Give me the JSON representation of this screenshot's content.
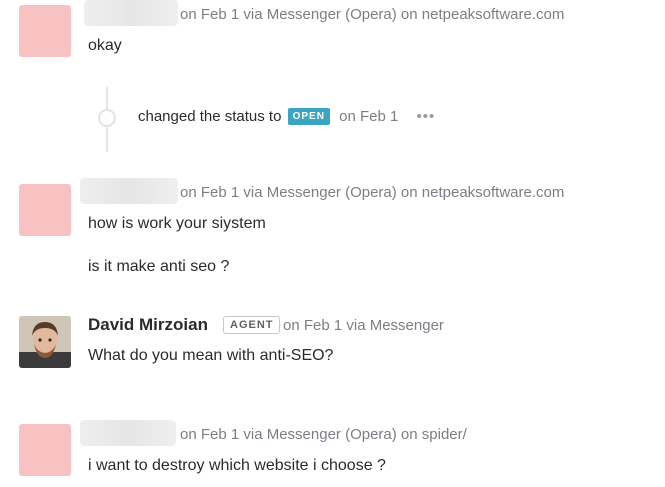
{
  "messages": [
    {
      "meta": "on Feb 1 via Messenger (Opera) on netpeaksoftware.com",
      "lines": [
        "okay"
      ]
    },
    {
      "meta": "on Feb 1 via Messenger (Opera) on netpeaksoftware.com",
      "lines": [
        "how is work your siystem",
        "is it make anti seo ?"
      ]
    },
    {
      "author": "David Mirzoian",
      "badge": "AGENT",
      "meta": "on Feb 1 via Messenger",
      "lines": [
        "What do you mean with anti-SEO?"
      ]
    },
    {
      "meta": "on Feb 1 via Messenger (Opera) on spider/",
      "lines": [
        "i want to destroy which website i choose ?"
      ]
    }
  ],
  "status_event": {
    "prefix": "changed the status to",
    "badge": "OPEN",
    "date": "on Feb 1",
    "more": "•••"
  },
  "colors": {
    "avatar_placeholder": "#f8c2c2",
    "status_open": "#3aa6c4",
    "meta_text": "#7a7f85"
  }
}
